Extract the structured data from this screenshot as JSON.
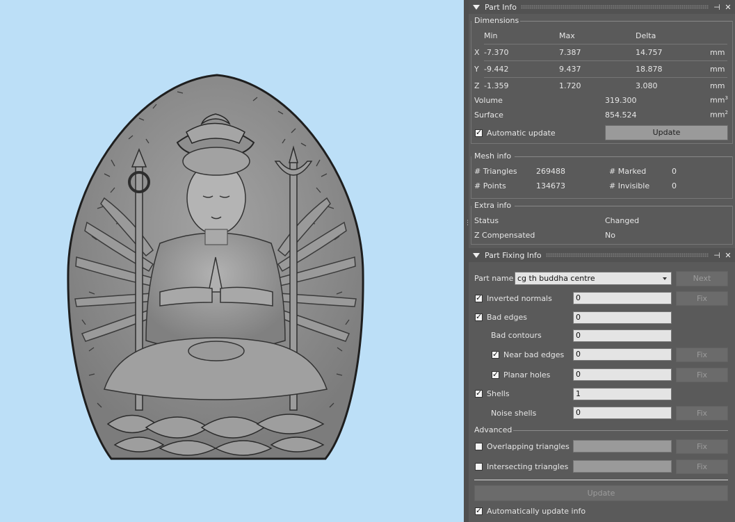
{
  "part_info": {
    "title": "Part Info",
    "dimensions": {
      "label": "Dimensions",
      "headers": {
        "min": "Min",
        "max": "Max",
        "delta": "Delta"
      },
      "rows": [
        {
          "axis": "X",
          "min": "-7.370",
          "max": "7.387",
          "delta": "14.757",
          "unit": "mm"
        },
        {
          "axis": "Y",
          "min": "-9.442",
          "max": "9.437",
          "delta": "18.878",
          "unit": "mm"
        },
        {
          "axis": "Z",
          "min": "-1.359",
          "max": "1.720",
          "delta": "3.080",
          "unit": "mm"
        }
      ],
      "volume_label": "Volume",
      "volume_value": "319.300",
      "volume_unit": "mm",
      "volume_exp": "3",
      "surface_label": "Surface",
      "surface_value": "854.524",
      "surface_unit": "mm",
      "surface_exp": "2",
      "auto_update_label": "Automatic update",
      "update_button": "Update"
    },
    "mesh_info": {
      "label": "Mesh info",
      "triangles_label": "# Triangles",
      "triangles_value": "269488",
      "marked_label": "# Marked",
      "marked_value": "0",
      "points_label": "# Points",
      "points_value": "134673",
      "invisible_label": "# Invisible",
      "invisible_value": "0"
    },
    "extra_info": {
      "label": "Extra info",
      "status_label": "Status",
      "status_value": "Changed",
      "zcomp_label": "Z Compensated",
      "zcomp_value": "No"
    }
  },
  "part_fixing": {
    "title": "Part Fixing Info",
    "part_name_label": "Part name",
    "part_name_value": "cg th buddha centre",
    "next_button": "Next",
    "fix_label": "Fix",
    "rows": {
      "inverted_normals": {
        "label": "Inverted normals",
        "value": "0"
      },
      "bad_edges": {
        "label": "Bad edges",
        "value": "0"
      },
      "bad_contours": {
        "label": "Bad contours",
        "value": "0"
      },
      "near_bad_edges": {
        "label": "Near bad edges",
        "value": "0"
      },
      "planar_holes": {
        "label": "Planar holes",
        "value": "0"
      },
      "shells": {
        "label": "Shells",
        "value": "1"
      },
      "noise_shells": {
        "label": "Noise shells",
        "value": "0"
      }
    },
    "advanced_label": "Advanced",
    "overlapping_label": "Overlapping triangles",
    "intersecting_label": "Intersecting triangles",
    "update_button": "Update",
    "auto_update_label": "Automatically update info"
  },
  "colors": {
    "viewport_bg": "#bcdff7",
    "panel_bg": "#5a5a5a",
    "model": "#8a8a8a"
  }
}
